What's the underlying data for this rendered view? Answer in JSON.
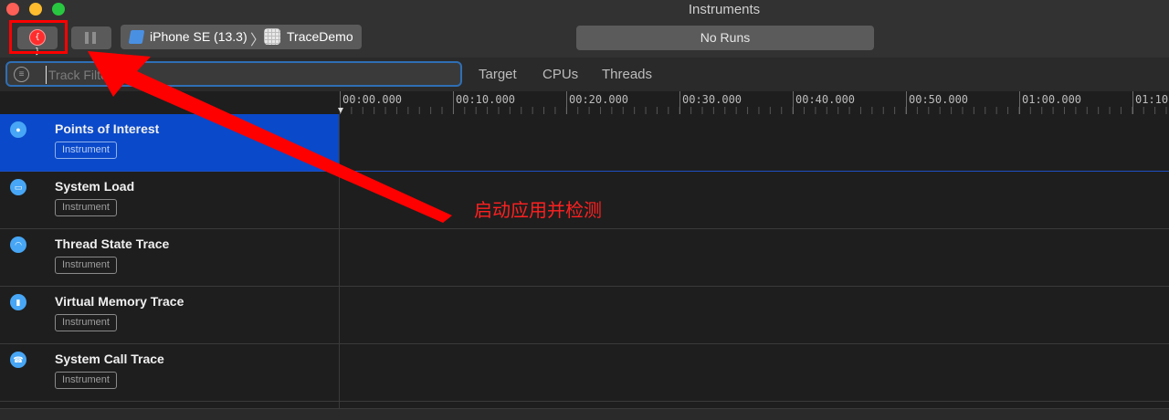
{
  "window": {
    "title": "Instruments"
  },
  "toolbar": {
    "record_icon": "record-icon",
    "record_glyph": "{ }",
    "pause_icon": "pause-icon",
    "device": "iPhone SE (13.3)",
    "separator_glyph": "〉",
    "target_app": "TraceDemo",
    "runs_label": "No Runs"
  },
  "filter": {
    "placeholder": "Track Filter",
    "tabs": [
      "Target",
      "CPUs",
      "Threads"
    ]
  },
  "timeline": {
    "ticks": [
      "00:00.000",
      "00:10.000",
      "00:20.000",
      "00:30.000",
      "00:40.000",
      "00:50.000",
      "01:00.000",
      "01:10.000"
    ]
  },
  "tracks": [
    {
      "name": "Points of Interest",
      "tag": "Instrument",
      "icon": "pin-icon",
      "glyph": "●",
      "selected": true
    },
    {
      "name": "System Load",
      "tag": "Instrument",
      "icon": "gauge-icon",
      "glyph": "▭",
      "selected": false
    },
    {
      "name": "Thread State Trace",
      "tag": "Instrument",
      "icon": "thread-state-icon",
      "glyph": "◠",
      "selected": false
    },
    {
      "name": "Virtual Memory Trace",
      "tag": "Instrument",
      "icon": "memory-icon",
      "glyph": "▮",
      "selected": false
    },
    {
      "name": "System Call Trace",
      "tag": "Instrument",
      "icon": "phone-icon",
      "glyph": "☎",
      "selected": false
    }
  ],
  "annotation": {
    "text": "启动应用并检测",
    "color": "#ff0000"
  },
  "colors": {
    "selection": "#0a49c9",
    "filter_focus": "#2f6fb5",
    "track_icon": "#47a6f5"
  }
}
